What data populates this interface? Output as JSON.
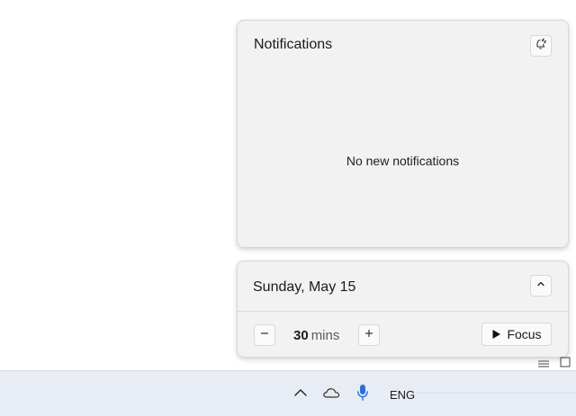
{
  "notifications": {
    "title": "Notifications",
    "empty_message": "No new notifications",
    "dnd_icon": "bell-snooze-icon"
  },
  "calendar": {
    "date": "Sunday, May 15",
    "collapse_icon": "chevron-up-icon"
  },
  "focus": {
    "duration_value": "30",
    "duration_unit": "mins",
    "minus_icon": "minus-icon",
    "plus_icon": "plus-icon",
    "button_label": "Focus",
    "button_icon": "play-icon"
  },
  "taskbar": {
    "tray_icons": [
      "chevron-up-icon",
      "onedrive-cloud-icon",
      "microphone-icon"
    ],
    "language": "ENG"
  },
  "colors": {
    "panel_bg": "#f2f2f2",
    "taskbar_bg": "#e7ecf5",
    "mic_accent": "#2b6fd6"
  }
}
